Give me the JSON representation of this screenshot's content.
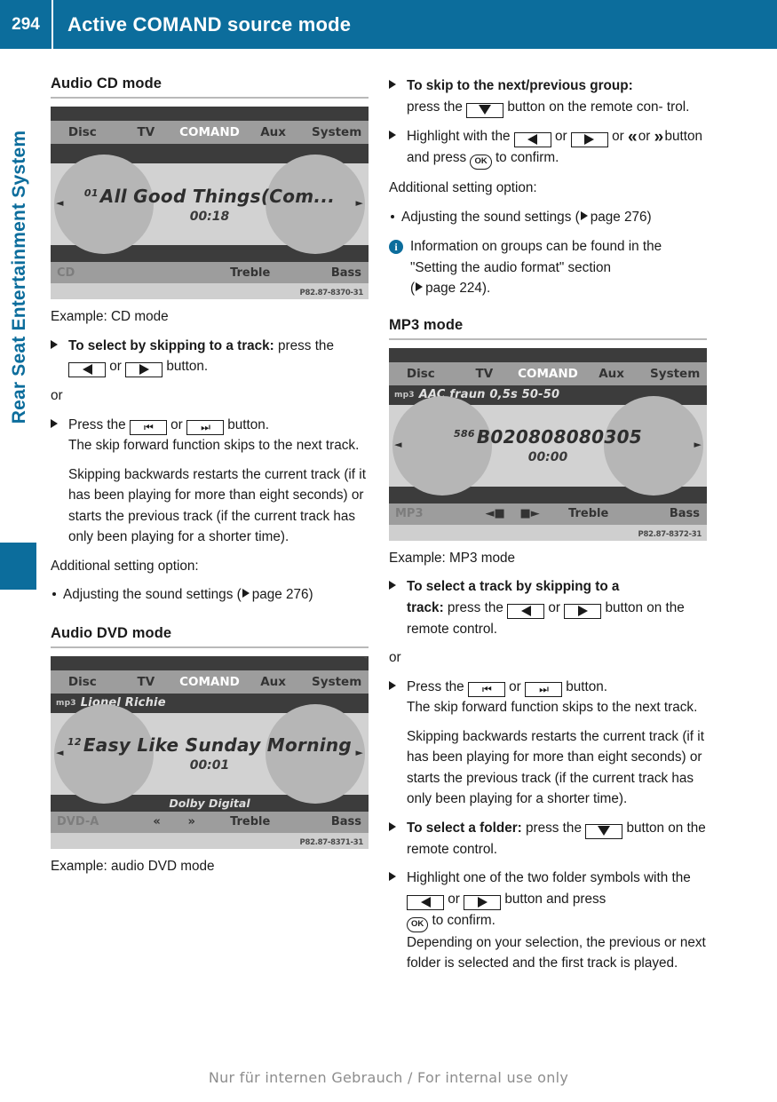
{
  "header": {
    "page_number": "294",
    "title": "Active COMAND source mode"
  },
  "side_band": {
    "chapter_title": "Rear Seat Entertainment System"
  },
  "footer": {
    "text": "Nur für internen Gebrauch / For internal use only"
  },
  "left_column": {
    "section1_title": "Audio CD mode",
    "cd_screen": {
      "menu": [
        "Disc",
        "TV",
        "COMAND",
        "Aux",
        "System"
      ],
      "selected_menu": "COMAND",
      "track_number": "01",
      "track_title": "All Good Things(Com...",
      "elapsed_time": "00:18",
      "nav_left": "◄",
      "nav_right": "►",
      "mode_label": "CD",
      "treble_label": "Treble",
      "bass_label": "Bass",
      "image_code": "P82.87-8370-31"
    },
    "caption1": "Example: CD mode",
    "step1_bold": "To select by skipping to a track:",
    "step1_rest_a": "press",
    "step1_rest_b": "the",
    "step1_rest_c": "or",
    "step1_rest_d": "button.",
    "or_label": "or",
    "step2_a": "Press the",
    "step2_b": "or",
    "step2_c": "button.",
    "para1": "The skip forward function skips to the next track.",
    "para2": "Skipping backwards restarts the current track (if it has been playing for more than eight seconds) or starts the previous track (if the current track has only been playing for a shorter time).",
    "additional_label": "Additional setting option:",
    "bullet1": "Adjusting the sound settings (",
    "bullet1_page": "page 276)",
    "section2_title": "Audio DVD mode",
    "dvd_screen": {
      "menu": [
        "Disc",
        "TV",
        "COMAND",
        "Aux",
        "System"
      ],
      "selected_menu": "COMAND",
      "artist": "Lionel Richie",
      "artist_tag": "mp3",
      "track_number": "12",
      "track_title": "Easy Like Sunday Morning",
      "elapsed_time": "00:01",
      "format": "Dolby Digital",
      "nav_left": "◄",
      "nav_right": "►",
      "mode_label": "DVD-A",
      "prev_symbol": "«",
      "next_symbol": "»",
      "treble_label": "Treble",
      "bass_label": "Bass",
      "corner_symbol": "ؔ",
      "image_code": "P82.87-8371-31"
    },
    "caption2": "Example: audio DVD mode"
  },
  "right_column": {
    "step1_bold": "To skip to the next/previous group:",
    "step1_a": "press the",
    "step1_b": "button on the remote con-",
    "step1_c": "trol.",
    "step2_a": "Highlight with the",
    "step2_b": "or",
    "step2_c": "or",
    "step2_d": "or",
    "step2_e": "button and press",
    "step2_f": "to confirm.",
    "additional_label": "Additional setting option:",
    "bullet1": "Adjusting the sound settings (",
    "bullet1_page": "page 276)",
    "note_line1": "Information on groups can be found in the",
    "note_line2": "\"Setting the audio format\" section",
    "note_line3": "page 224).",
    "section_title": "MP3 mode",
    "mp3_screen": {
      "menu": [
        "Disc",
        "TV",
        "COMAND",
        "Aux",
        "System"
      ],
      "selected_menu": "COMAND",
      "band_text": "AAC fraun 0,5s 50-50",
      "band_tag": "mp3",
      "track_number": "586",
      "track_title": "B020808080305",
      "elapsed_time": "00:00",
      "nav_left": "◄",
      "nav_right": "►",
      "mode_label": "MP3",
      "folder_prev": "◄■",
      "folder_next": "■►",
      "treble_label": "Treble",
      "bass_label": "Bass",
      "image_code": "P82.87-8372-31"
    },
    "caption": "Example: MP3 mode",
    "step3_bold_a": "To select a track by skipping to a",
    "step3_bold_b": "track:",
    "step3_a": "press the",
    "step3_b": "or",
    "step3_c": "button on",
    "step3_d": "the remote control.",
    "or_label": "or",
    "step4_a": "Press the",
    "step4_b": "or",
    "step4_c": "button.",
    "para1": "The skip forward function skips to the next track.",
    "para2": "Skipping backwards restarts the current track (if it has been playing for more than eight seconds) or starts the previous track (if the current track has only been playing for a shorter time).",
    "step5_bold": "To select a folder:",
    "step5_a": "press the",
    "step5_b": "button",
    "step5_c": "on the remote control.",
    "step6_a": "Highlight one of the two folder symbols",
    "step6_b": "with the",
    "step6_c": "or",
    "step6_d": "button and press",
    "step6_e": "to confirm.",
    "step6_f": "Depending on your selection, the previous or next folder is selected and the first track is played."
  },
  "colors": {
    "brand_blue": "#0c6d9c",
    "rule_gray": "#b9b9b9",
    "text": "#1a1a1a"
  }
}
